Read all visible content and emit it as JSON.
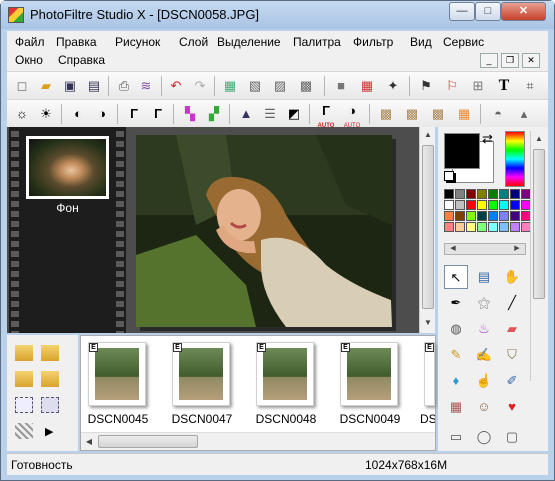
{
  "window": {
    "title": "PhotoFiltre Studio X - [DSCN0058.JPG]",
    "minimize_glyph": "—",
    "maximize_glyph": "□",
    "close_glyph": "✕"
  },
  "menu": {
    "items": [
      "Файл",
      "Правка",
      "Рисунок",
      "Слой",
      "Выделение",
      "Палитра",
      "Фильтр",
      "Вид",
      "Сервис",
      "Окно",
      "Справка"
    ],
    "mdi": {
      "minimize": "_",
      "restore": "❐",
      "close": "✕"
    }
  },
  "toolbar1": {
    "icons": [
      "new-file-icon",
      "open-file-icon",
      "save-icon",
      "save-as-icon",
      "print-icon",
      "scan-icon",
      "undo-icon",
      "redo-icon",
      "paste-as-image-icon",
      "duplicate-icon",
      "copy-icon",
      "resize-icon",
      "color-count-icon",
      "automate-icon",
      "batch-icon",
      "plugin-icon",
      "lasso-icon",
      "gradient-icon",
      "text-icon",
      "crop-icon"
    ],
    "text_tool_glyph": "T"
  },
  "toolbar2": {
    "icons": [
      "brightness-minus-icon",
      "brightness-plus-icon",
      "contrast-minus-icon",
      "contrast-plus-icon",
      "gamma-minus-icon",
      "gamma-plus-icon",
      "saturation-minus-icon",
      "saturation-plus-icon",
      "histogram-icon",
      "levels-icon",
      "invert-icon",
      "auto-gamma-icon",
      "auto-contrast-icon",
      "pattern-1-icon",
      "pattern-2-icon",
      "pattern-3-icon",
      "blur-icon",
      "sharpen-icon"
    ],
    "gamma_glyph": "Γ",
    "auto_label": "AUTO"
  },
  "layers": {
    "items": [
      {
        "label": "Фон"
      }
    ]
  },
  "browser": {
    "files": [
      {
        "name": "DSCN0045",
        "badge": "E"
      },
      {
        "name": "DSCN0047",
        "badge": "E"
      },
      {
        "name": "DSCN0048",
        "badge": "E"
      },
      {
        "name": "DSCN0049",
        "badge": "E"
      },
      {
        "name": "DS",
        "badge": "E"
      }
    ]
  },
  "tools": {
    "selected": "selection-arrow",
    "icons": [
      "selection-arrow-icon",
      "layer-manager-icon",
      "hand-icon",
      "eyedropper-icon",
      "magic-wand-icon",
      "line-icon",
      "fill-bucket-icon",
      "spray-icon",
      "eraser-icon",
      "brush-icon",
      "advanced-brush-icon",
      "stamp-icon",
      "blur-drop-icon",
      "finger-icon",
      "clone-icon",
      "pattern-icon",
      "portrait-icon",
      "strawberry-icon",
      "rectangle-icon",
      "ellipse-icon",
      "rounded-rect-icon"
    ]
  },
  "palette": {
    "colors": [
      "#000000",
      "#808080",
      "#800000",
      "#808000",
      "#008000",
      "#008080",
      "#000080",
      "#800080",
      "#ffffff",
      "#c0c0c0",
      "#ff0000",
      "#ffff00",
      "#00ff00",
      "#00ffff",
      "#0000ff",
      "#ff00ff",
      "#ff8040",
      "#804000",
      "#80ff00",
      "#004040",
      "#0080ff",
      "#8080ff",
      "#400080",
      "#ff0080",
      "#ff8080",
      "#ffcc99",
      "#ffff80",
      "#80ff80",
      "#80ffff",
      "#80c0ff",
      "#c080ff",
      "#ff80c0"
    ]
  },
  "status": {
    "left": "Готовность",
    "right": "1024x768x16M"
  }
}
